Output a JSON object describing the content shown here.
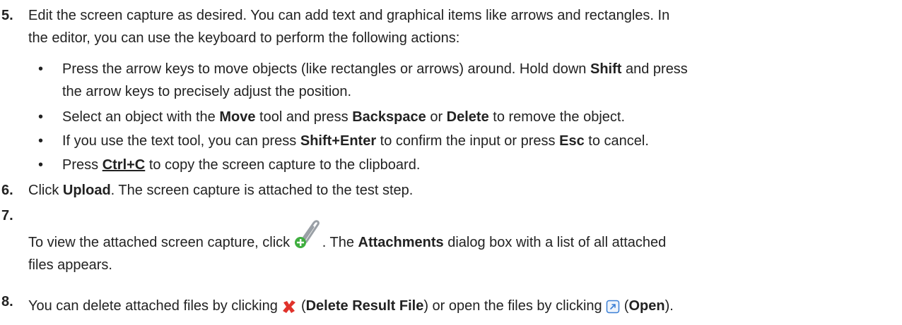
{
  "steps": [
    {
      "number": "5.",
      "line1": "Edit the screen capture as desired. You can add text and graphical items like arrows and rectangles. In",
      "line2": "the editor, you can use the keyboard to perform the following actions:",
      "bullets": [
        {
          "a": "Press the arrow keys to move objects (like rectangles or arrows) around. Hold down ",
          "b": "Shift",
          "c": " and press",
          "d": "the arrow keys to precisely adjust the position."
        },
        {
          "a": "Select an object with the ",
          "b": "Move",
          "c": " tool and press ",
          "d": "Backspace",
          "e": " or ",
          "f": "Delete",
          "g": " to remove the object."
        },
        {
          "a": "If you use the text tool, you can press ",
          "b": "Shift+Enter",
          "c": " to confirm the input or press ",
          "d": "Esc",
          "e": " to cancel."
        },
        {
          "a": "Press ",
          "b": "Ctrl+C",
          "c": " to copy the screen capture to the clipboard."
        }
      ]
    },
    {
      "number": "6.",
      "a": "Click ",
      "b": "Upload",
      "c": ". The screen capture is attached to the test step."
    },
    {
      "number": "7.",
      "a": "To view the attached screen capture, click ",
      "b": ". The ",
      "c": "Attachments",
      "d": " dialog box with a list of all attached",
      "e": "files appears.",
      "icon": "paperclip-add-icon"
    },
    {
      "number": "8.",
      "a": "You can delete attached files by clicking ",
      "b": " (",
      "c": "Delete Result File",
      "d": ") or open the files by clicking ",
      "e": " (",
      "f": "Open",
      "g": ").",
      "icons": [
        "red-x-delete-icon",
        "open-external-icon"
      ]
    }
  ],
  "colors": {
    "text": "#222222",
    "delete_red": "#e0322b",
    "open_blue": "#3a7fd5",
    "clip_green": "#3fae3f"
  }
}
